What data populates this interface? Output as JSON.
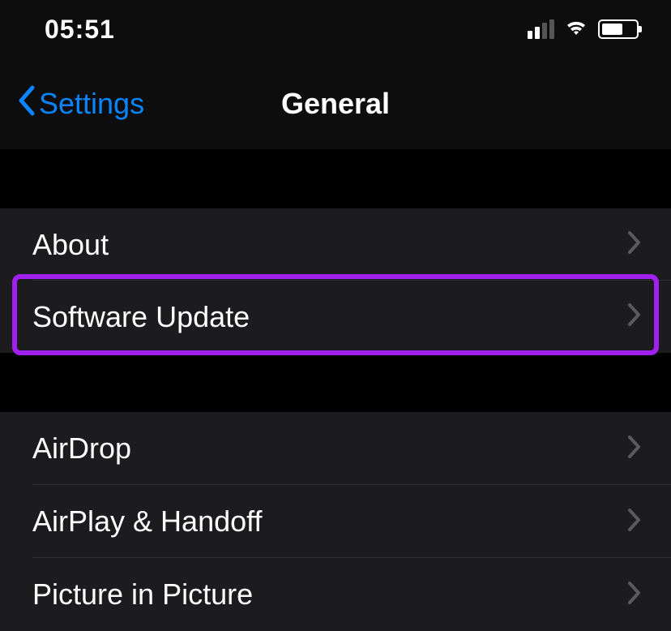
{
  "status": {
    "time": "05:51"
  },
  "nav": {
    "back_label": "Settings",
    "title": "General"
  },
  "group1": [
    {
      "label": "About"
    },
    {
      "label": "Software Update"
    }
  ],
  "group2": [
    {
      "label": "AirDrop"
    },
    {
      "label": "AirPlay & Handoff"
    },
    {
      "label": "Picture in Picture"
    }
  ],
  "colors": {
    "accent": "#0a84ff",
    "highlight": "#a020f0"
  }
}
